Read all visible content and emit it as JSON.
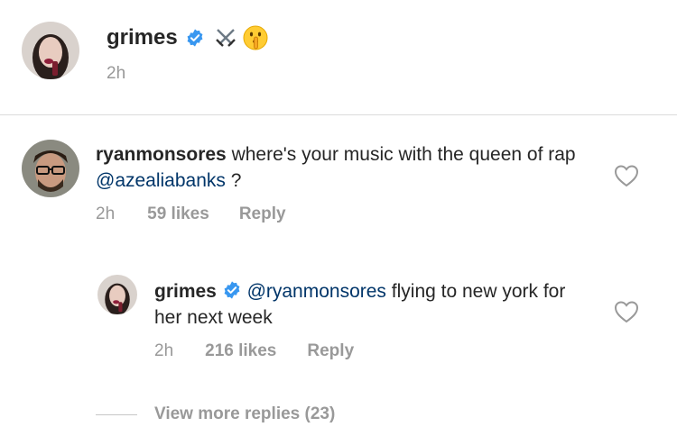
{
  "post": {
    "username": "grimes",
    "timestamp": "2h",
    "icons": [
      "verified-badge-icon",
      "crossed-swords-icon",
      "shushing-face-icon"
    ]
  },
  "comment": {
    "username": "ryanmonsores",
    "text_before": "where's your music with the queen of rap ",
    "mention": "@azealiabanks",
    "text_after": " ?",
    "time": "2h",
    "likes": "59 likes",
    "reply_label": "Reply"
  },
  "reply": {
    "username": "grimes",
    "mention": "@ryanmonsores",
    "text": " flying to new york for her next week",
    "time": "2h",
    "likes": "216 likes",
    "reply_label": "Reply"
  },
  "view_more": "View more replies (23)",
  "colors": {
    "text": "#262626",
    "meta": "#999999",
    "mention": "#003569",
    "verified": "#3897f0",
    "divider": "#dbdbdb"
  }
}
